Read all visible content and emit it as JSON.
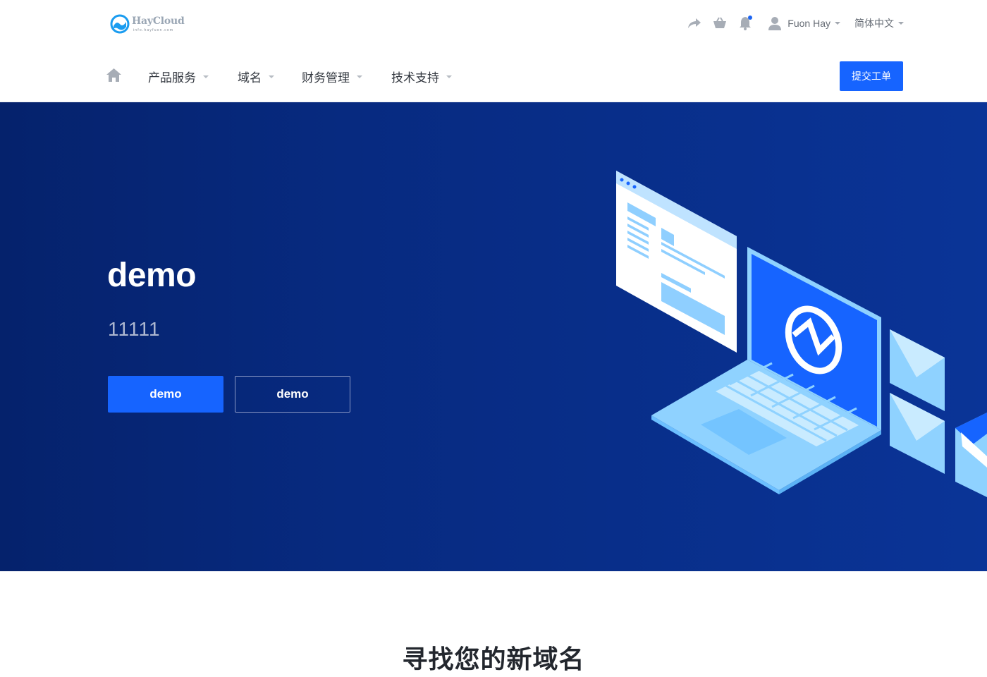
{
  "brand": {
    "name": "HayCloud",
    "tagline": "info.hayfuon.com"
  },
  "topbar": {
    "user_name": "Fuon Hay",
    "language": "简体中文",
    "icons": [
      "share-icon",
      "cart-icon",
      "bell-icon",
      "user-icon"
    ]
  },
  "nav": {
    "items": [
      {
        "label": "产品服务"
      },
      {
        "label": "域名"
      },
      {
        "label": "财务管理"
      },
      {
        "label": "技术支持"
      }
    ],
    "ticket_button": "提交工单"
  },
  "hero": {
    "title": "demo",
    "subtitle": "11111",
    "primary_button": "demo",
    "secondary_button": "demo"
  },
  "section": {
    "title": "寻找您的新域名"
  },
  "colors": {
    "accent": "#1664ff",
    "hero_bg_dark": "#05226c",
    "hero_bg_light": "#0a3497"
  }
}
